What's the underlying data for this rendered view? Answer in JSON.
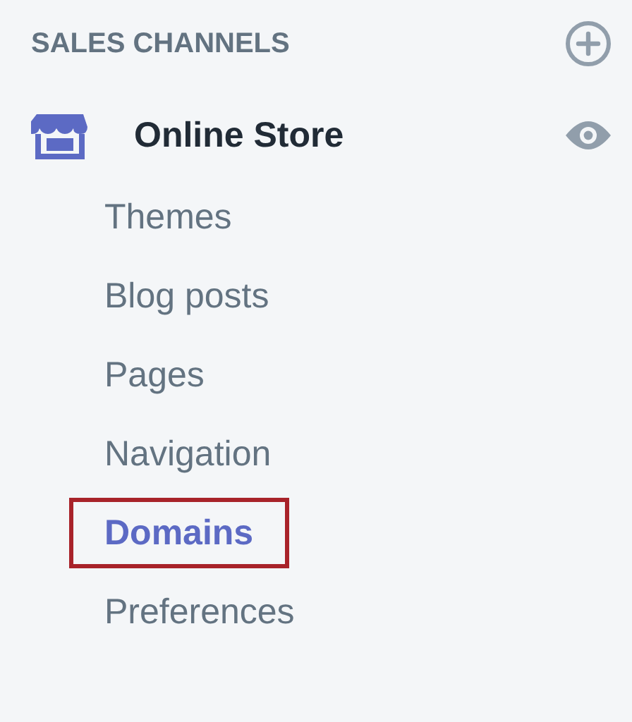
{
  "section": {
    "title": "SALES CHANNELS"
  },
  "channel": {
    "name": "Online Store"
  },
  "items": [
    {
      "label": "Themes",
      "selected": false,
      "highlighted": false
    },
    {
      "label": "Blog posts",
      "selected": false,
      "highlighted": false
    },
    {
      "label": "Pages",
      "selected": false,
      "highlighted": false
    },
    {
      "label": "Navigation",
      "selected": false,
      "highlighted": false
    },
    {
      "label": "Domains",
      "selected": true,
      "highlighted": true
    },
    {
      "label": "Preferences",
      "selected": false,
      "highlighted": false
    }
  ]
}
